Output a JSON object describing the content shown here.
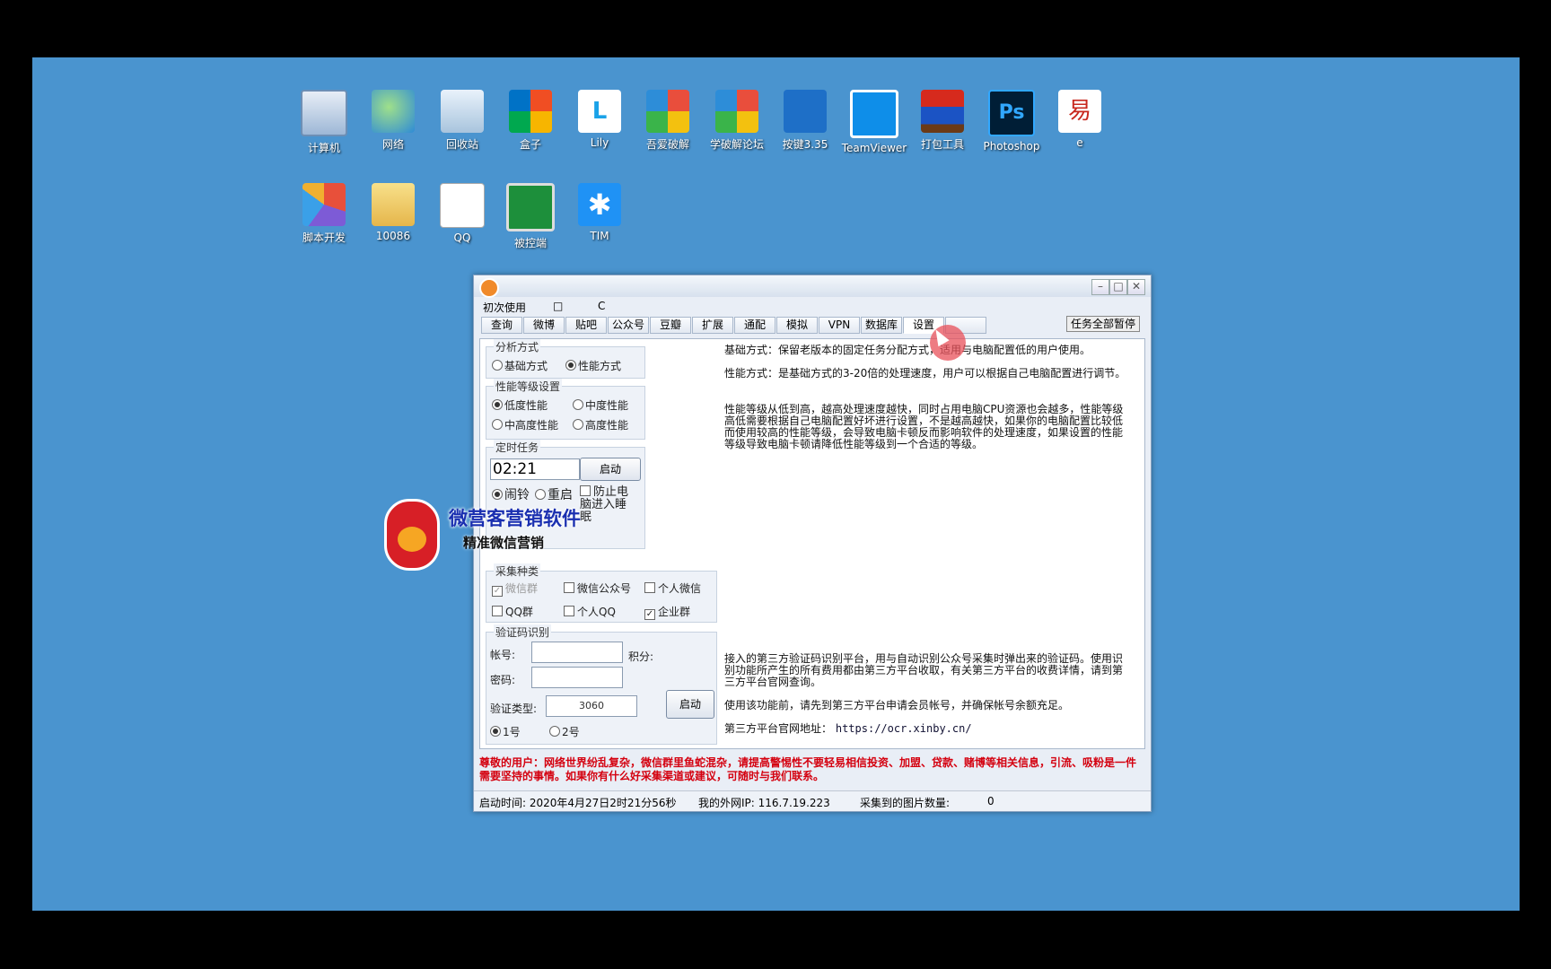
{
  "desktop": {
    "icons": [
      {
        "label": "计算机",
        "name": "computer-icon"
      },
      {
        "label": "网络",
        "name": "network-icon"
      },
      {
        "label": "回收站",
        "name": "recycle-bin-icon"
      },
      {
        "label": "盒子",
        "name": "box-icon"
      },
      {
        "label": "Lily",
        "name": "lily-icon"
      },
      {
        "label": "吾爱破解",
        "name": "52pojie-icon"
      },
      {
        "label": "学破解论坛",
        "name": "forum-icon"
      },
      {
        "label": "按键3.35",
        "name": "anjian-icon"
      },
      {
        "label": "TeamViewer",
        "name": "teamviewer-icon"
      },
      {
        "label": "打包工具",
        "name": "pack-tool-icon"
      },
      {
        "label": "Photoshop",
        "name": "photoshop-icon"
      },
      {
        "label": "e",
        "name": "e-language-icon"
      },
      {
        "label": "脚本开发",
        "name": "script-dev-icon"
      },
      {
        "label": "10086",
        "name": "folder-icon"
      },
      {
        "label": "QQ",
        "name": "qq-file-icon"
      },
      {
        "label": "被控端",
        "name": "controlled-pc-icon"
      },
      {
        "label": "TIM",
        "name": "tim-icon"
      }
    ]
  },
  "window": {
    "menu": {
      "first_use": "初次使用",
      "item2": "□",
      "item3": "C"
    },
    "tabs": [
      "查询",
      "微博",
      "贴吧",
      "公众号",
      "豆瓣",
      "扩展",
      "通配",
      "模拟",
      "VPN",
      "数据库",
      "设置",
      ""
    ],
    "pause_all": "任务全部暂停",
    "analysis": {
      "title": "分析方式",
      "opt1": "基础方式",
      "opt2": "性能方式",
      "selected": "性能方式"
    },
    "perf": {
      "title": "性能等级设置",
      "opt1": "低度性能",
      "opt2": "中度性能",
      "opt3": "中高度性能",
      "opt4": "高度性能",
      "selected": "低度性能"
    },
    "timer": {
      "title": "定时任务",
      "time": "02:21",
      "start": "启动",
      "alarm": "闹铃",
      "restart": "重启",
      "prevent_sleep": "防止电脑进入睡眠"
    },
    "collect": {
      "title": "采集种类",
      "items": [
        "微信群",
        "微信公众号",
        "个人微信",
        "QQ群",
        "个人QQ",
        "企业群"
      ]
    },
    "captcha": {
      "title": "验证码识别",
      "account_label": "帐号:",
      "points_label": "积分:",
      "password_label": "密码:",
      "type_label": "验证类型:",
      "type_value": "3060",
      "start": "启动",
      "opt1": "1号",
      "opt2": "2号"
    },
    "desc": {
      "basic": "基础方式：保留老版本的固定任务分配方式，适用与电脑配置低的用户使用。",
      "perf": "性能方式：是基础方式的3-20倍的处理速度，用户可以根据自己电脑配置进行调节。",
      "levels": "性能等级从低到高，越高处理速度越快，同时占用电脑CPU资源也会越多，性能等级高低需要根据自己电脑配置好坏进行设置，不是越高越快，如果你的电脑配置比较低而使用较高的性能等级，会导致电脑卡顿反而影响软件的处理速度，如果设置的性能等级导致电脑卡顿请降低性能等级到一个合适的等级。",
      "third": "接入的第三方验证码识别平台，用与自动识别公众号采集时弹出来的验证码。使用识别功能所产生的所有费用都由第三方平台收取，有关第三方平台的收费详情，请到第三方平台官网查询。",
      "before": "使用该功能前，请先到第三方平台申请会员帐号，并确保帐号余额充足。",
      "site_label": "第三方平台官网地址：",
      "site_url": "https://ocr.xinby.cn/"
    },
    "warning": "尊敬的用户：网络世界纷乱复杂，微信群里鱼蛇混杂，请提高警惕性不要轻易相信投资、加盟、贷款、赌博等相关信息，引流、吸粉是一件需要坚持的事情。如果你有什么好采集渠道或建议，可随时与我们联系。",
    "status": {
      "start_time": "启动时间: 2020年4月27日2时21分56秒",
      "ip": "我的外网IP: 116.7.19.223",
      "images": "采集到的图片数量:",
      "images_count": "0"
    }
  },
  "watermark": {
    "title": "微营客营销软件",
    "subtitle": "精准微信营销"
  }
}
